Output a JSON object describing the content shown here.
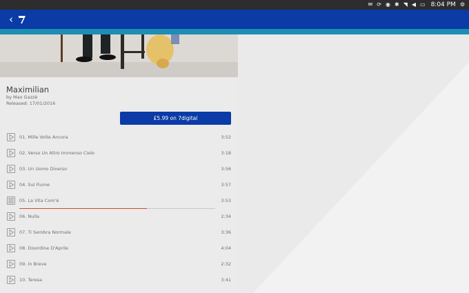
{
  "system_bar": {
    "indicators": [
      "mail-icon",
      "sync-icon",
      "location-icon",
      "bluetooth-icon",
      "wifi-icon",
      "volume-icon",
      "battery-icon",
      "power-icon"
    ],
    "time": "8:04 PM"
  },
  "header": {
    "back_icon": "chevron-left-icon",
    "logo_icon": "7digital-logo"
  },
  "album": {
    "title": "Maximilian",
    "artist": "by Max Gazzè",
    "released": "Released: 17/01/2016",
    "buy_label": "£5.99 on 7digital"
  },
  "tracks": [
    {
      "name": "01. Mille Volte Ancora",
      "duration": "3:52",
      "state": "play"
    },
    {
      "name": "02. Verso Un Altro Immenso Cielo",
      "duration": "3:18",
      "state": "play"
    },
    {
      "name": "03. Un Uomo Diverso",
      "duration": "3:56",
      "state": "play"
    },
    {
      "name": "04. Sul Fiume",
      "duration": "3:57",
      "state": "play"
    },
    {
      "name": "05. La Vita Com'è",
      "duration": "3:53",
      "state": "pause",
      "progress": 0.65
    },
    {
      "name": "06. Nulla",
      "duration": "2:34",
      "state": "play"
    },
    {
      "name": "07. Ti Sembra Normale",
      "duration": "3:36",
      "state": "play"
    },
    {
      "name": "08. Disordine D'Aprile",
      "duration": "4:04",
      "state": "play"
    },
    {
      "name": "09. In Breve",
      "duration": "2:32",
      "state": "play"
    },
    {
      "name": "10. Teresa",
      "duration": "3:41",
      "state": "play"
    }
  ],
  "colors": {
    "header": "#0a3ba6",
    "accent_strip": "#1d8fb2",
    "progress": "#c4502a"
  }
}
